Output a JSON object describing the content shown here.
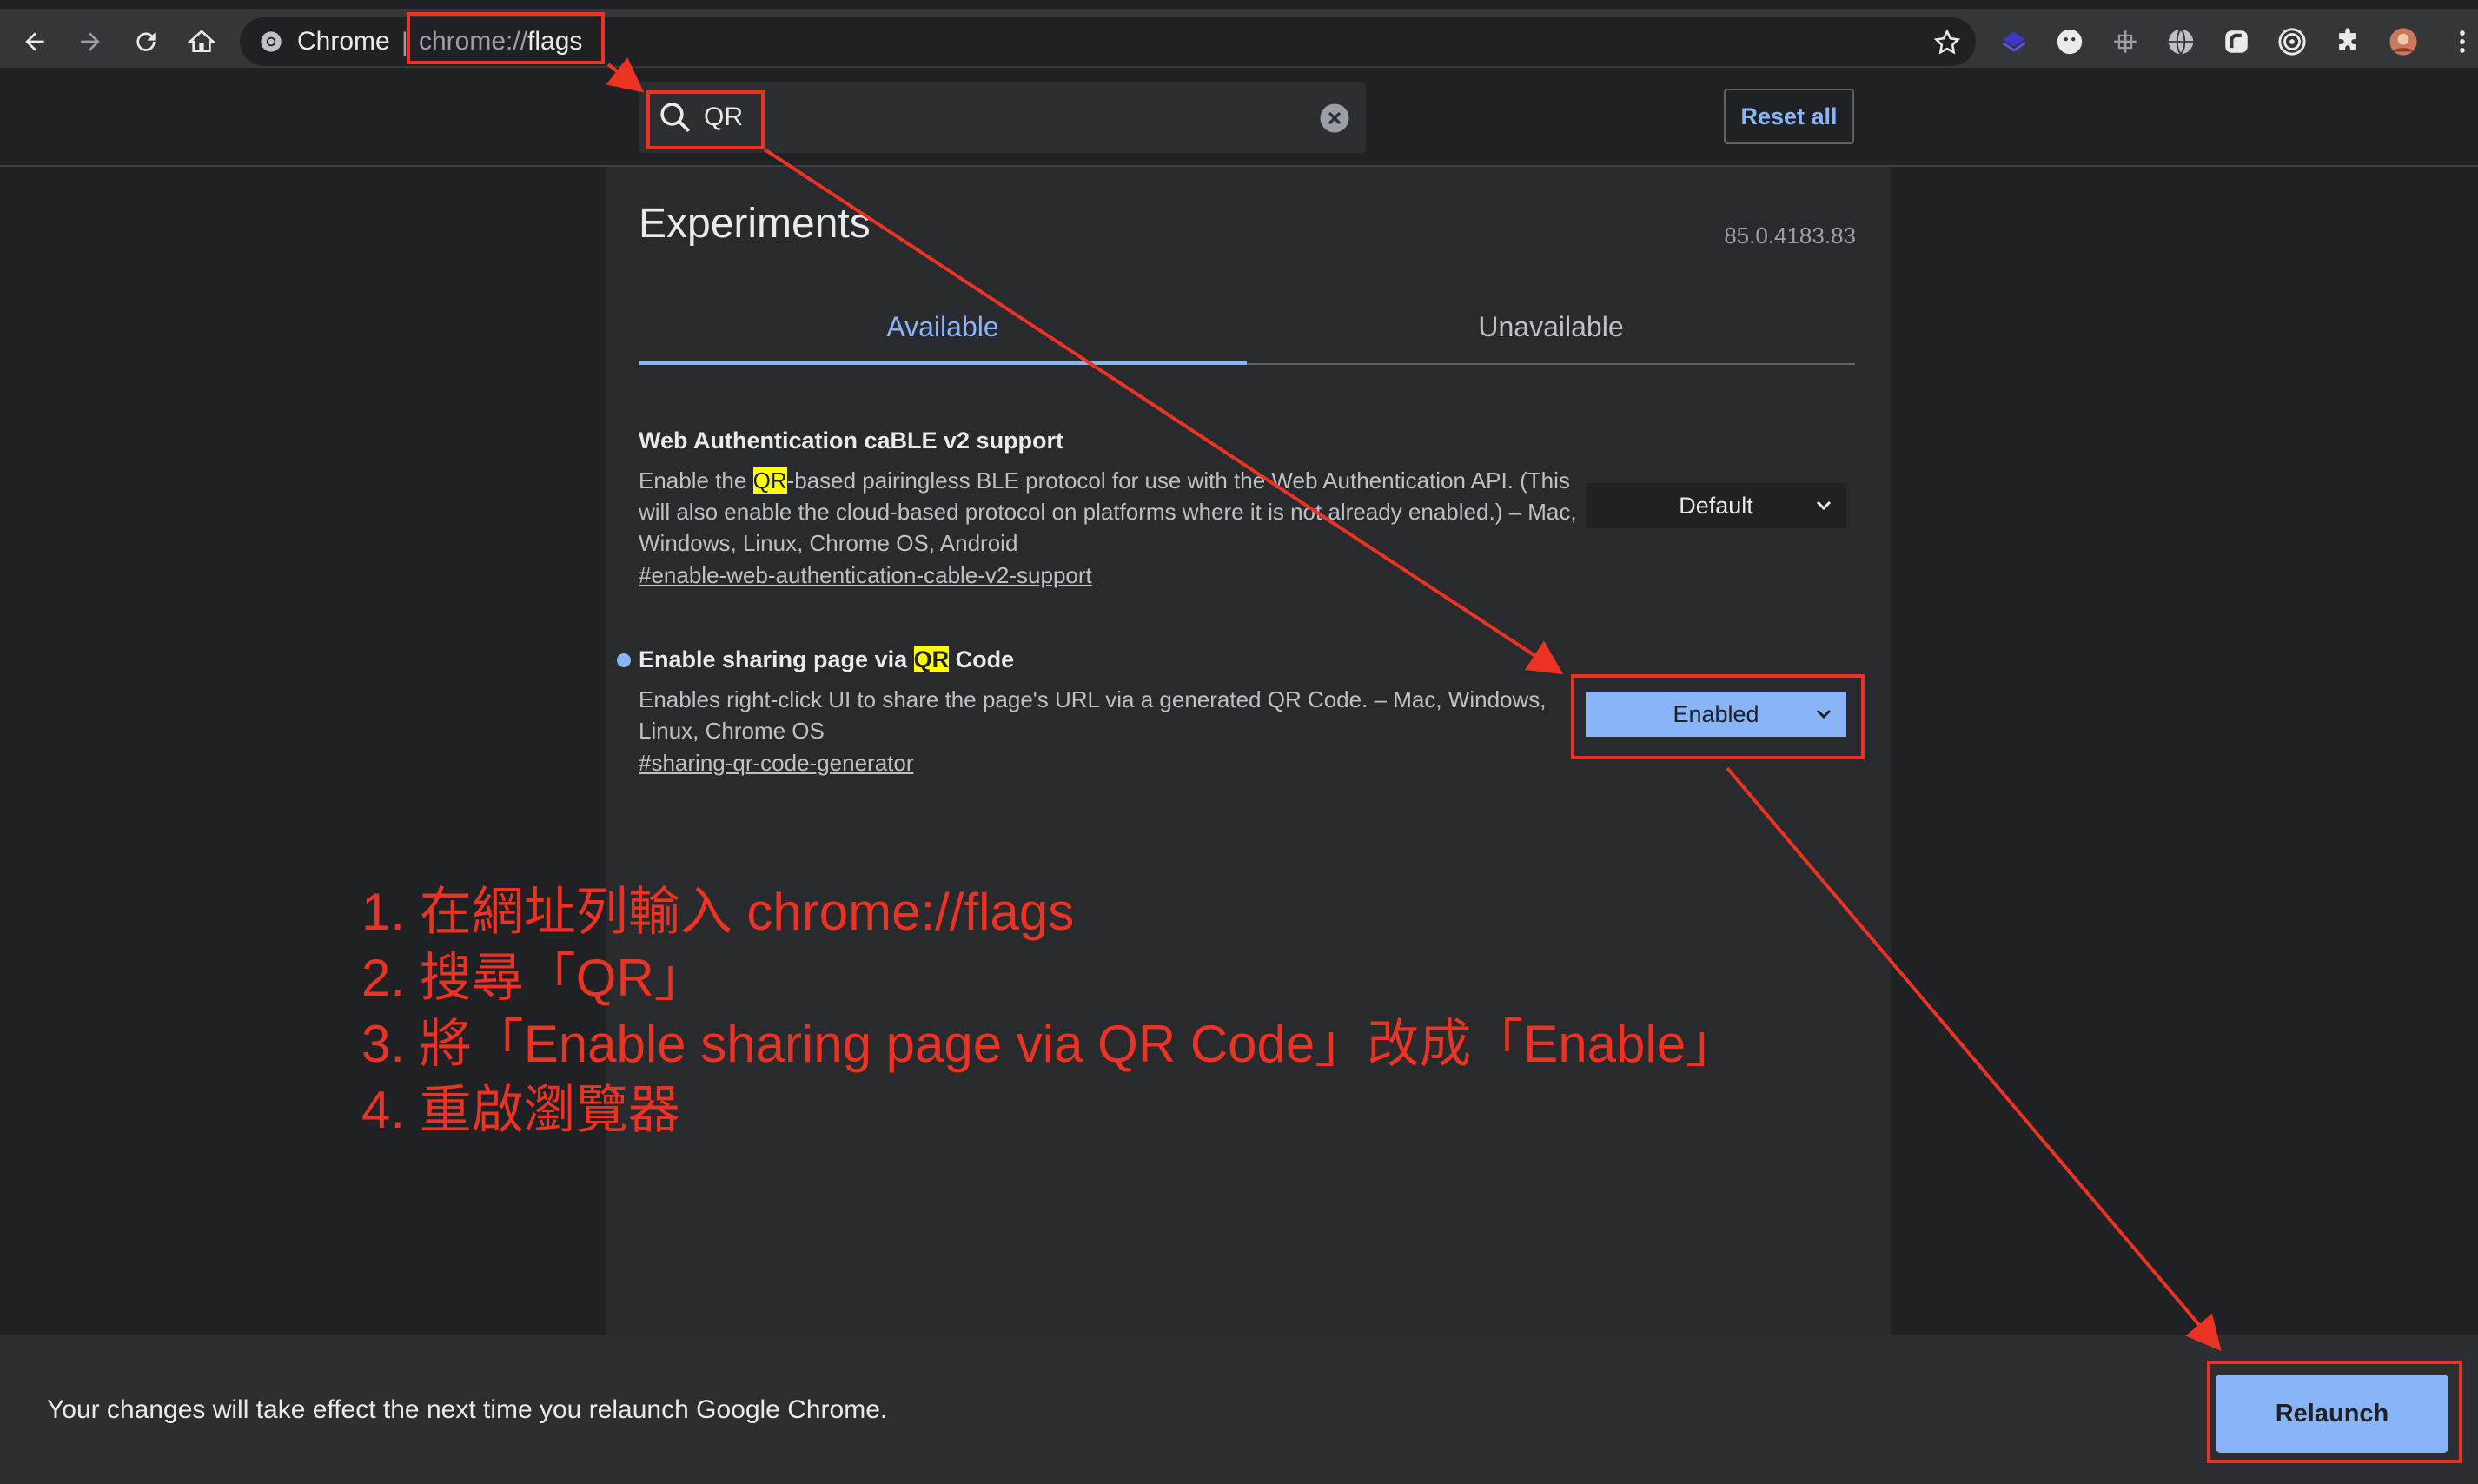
{
  "browser": {
    "site_chip_label": "Chrome",
    "url_prefix": "chrome://",
    "url_path": "flags"
  },
  "search": {
    "value": "QR",
    "reset_label": "Reset all"
  },
  "main": {
    "title": "Experiments",
    "version": "85.0.4183.83",
    "tabs": [
      {
        "label": "Available"
      },
      {
        "label": "Unavailable"
      }
    ]
  },
  "flags": [
    {
      "title": "Web Authentication caBLE v2 support",
      "desc_before": "Enable the ",
      "desc_highlight": "QR",
      "desc_after": "-based pairingless BLE protocol for use with the Web Authentication API. (This will also enable the cloud-based protocol on platforms where it is not already enabled.) – Mac, Windows, Linux, Chrome OS, Android",
      "link": "#enable-web-authentication-cable-v2-support",
      "select_value": "Default"
    },
    {
      "title_before": "Enable sharing page via ",
      "title_highlight": "QR",
      "title_after": " Code",
      "desc": "Enables right-click UI to share the page's URL via a generated QR Code. – Mac, Windows, Linux, Chrome OS",
      "link": "#sharing-qr-code-generator",
      "select_value": "Enabled"
    }
  ],
  "annotation": {
    "lines": [
      "1. 在網址列輸入 chrome://flags",
      "2. 搜尋「QR」",
      "3. 將「Enable sharing page via QR Code」改成「Enable」",
      "4. 重啟瀏覽器"
    ],
    "color": "#ea3323"
  },
  "banner": {
    "message": "Your changes will take effect the next time you relaunch Google Chrome.",
    "relaunch_label": "Relaunch"
  },
  "colors": {
    "accent": "#8ab4f8",
    "highlight": "#ffff00",
    "background": "#202124",
    "content_background": "#292a2d"
  }
}
